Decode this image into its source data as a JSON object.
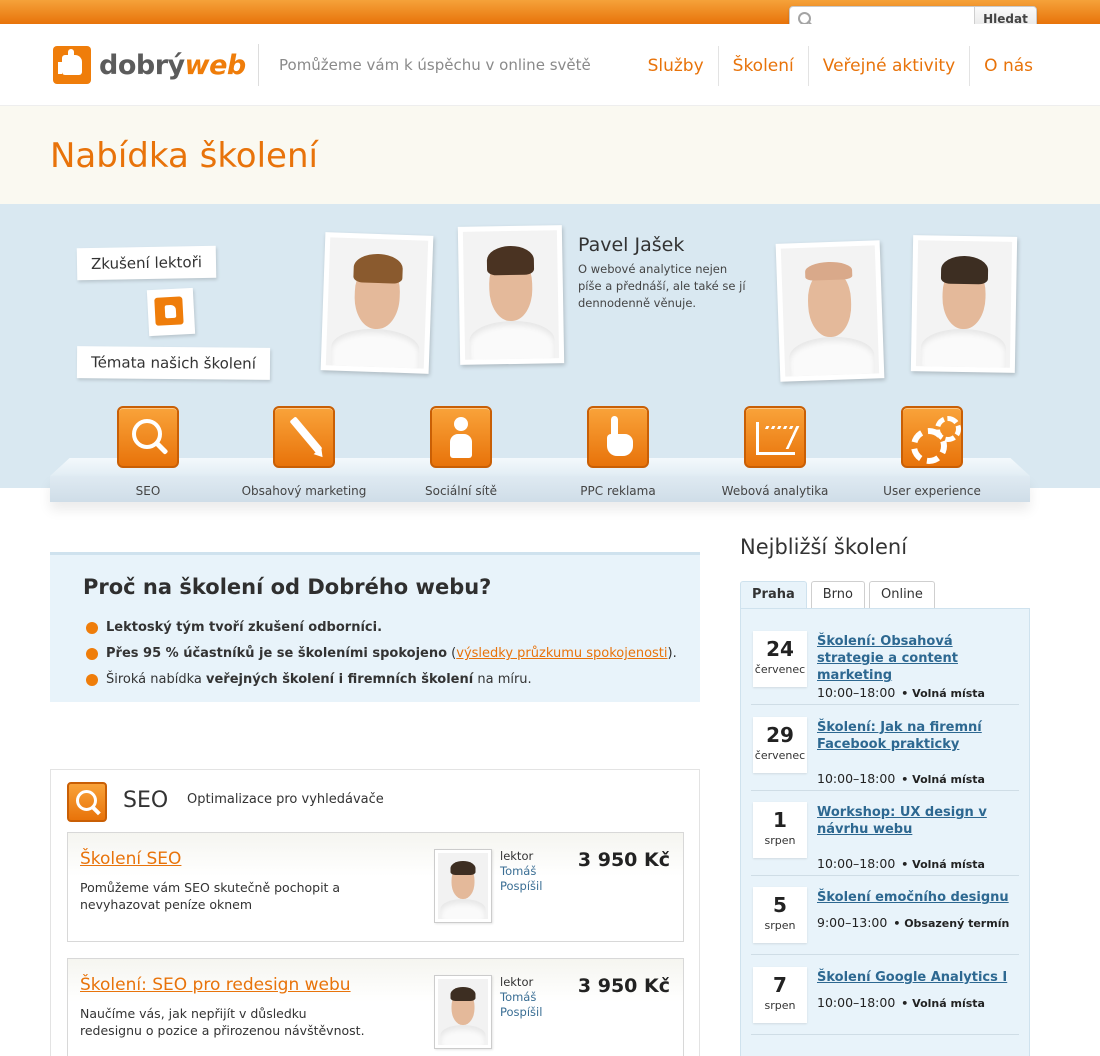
{
  "search": {
    "placeholder": "",
    "button_label": "Hledat"
  },
  "header": {
    "logo_part1": "dobrý",
    "logo_part2": "web",
    "tagline": "Pomůžeme vám k úspěchu v online světě",
    "nav": [
      "Služby",
      "Školení",
      "Veřejné aktivity",
      "O nás"
    ]
  },
  "page_title": "Nabídka školení",
  "hero": {
    "note_lectors": "Zkušení lektoři",
    "note_topics": "Témata našich školení",
    "featured_lector": {
      "name": "Pavel Jašek",
      "description": "O webové analytice nejen píše a přednáší, ale také se jí dennodenně věnuje."
    },
    "topics": [
      "SEO",
      "Obsahový marketing",
      "Sociální sítě",
      "PPC reklama",
      "Webová analytika",
      "User experience"
    ]
  },
  "why": {
    "title": "Proč na školení od Dobrého webu?",
    "item1": "Lektoský tým tvoří zkušení odborníci.",
    "item2_bold": "Přes 95 % účastníků je se školeními spokojeno",
    "item2_open": " (",
    "item2_link": "výsledky průzkumu spokojenosti",
    "item2_close": ").",
    "item3_pre": "Široká nabídka ",
    "item3_bold": "veřejných školení i firemních školení",
    "item3_post": " na míru."
  },
  "seo": {
    "title": "SEO",
    "subtitle": "Optimalizace pro vyhledávače",
    "courses": [
      {
        "name": "Školení SEO",
        "desc": "Pomůžeme vám SEO skutečně pochopit a nevyhazovat peníze oknem",
        "lector_label": "lektor",
        "lector_first": "Tomáš",
        "lector_last": "Pospíšil",
        "price": "3 950 Kč"
      },
      {
        "name": "Školení: SEO pro redesign webu",
        "desc": "Naučíme vás, jak nepřijít v důsledku redesignu o pozice a přirozenou návštěvnost.",
        "lector_label": "lektor",
        "lector_first": "Tomáš",
        "lector_last": "Pospíšil",
        "price": "3 950 Kč"
      }
    ]
  },
  "sidebar": {
    "title": "Nejbližší školení",
    "tabs": [
      "Praha",
      "Brno",
      "Online"
    ],
    "events": [
      {
        "day": "24",
        "month": "červenec",
        "title": "Školení: Obsahová strategie a content marketing",
        "time": "10:00–18:00",
        "status": "• Volná místa"
      },
      {
        "day": "29",
        "month": "červenec",
        "title": "Školení: Jak na firemní Facebook prakticky",
        "time": "10:00–18:00",
        "status": "• Volná místa"
      },
      {
        "day": "1",
        "month": "srpen",
        "title": "Workshop: UX design v návrhu webu",
        "time": "10:00–18:00",
        "status": "• Volná místa"
      },
      {
        "day": "5",
        "month": "srpen",
        "title": "Školení emočního designu",
        "time": "9:00–13:00",
        "status": "• Obsazený termín"
      },
      {
        "day": "7",
        "month": "srpen",
        "title": "Školení Google Analytics I",
        "time": "10:00–18:00",
        "status": "• Volná místa"
      }
    ]
  },
  "colors": {
    "accent": "#e8730a",
    "link_blue": "#2d6891",
    "hero_bg": "#d9e8f1",
    "panel_bg": "#e8f3fa"
  }
}
